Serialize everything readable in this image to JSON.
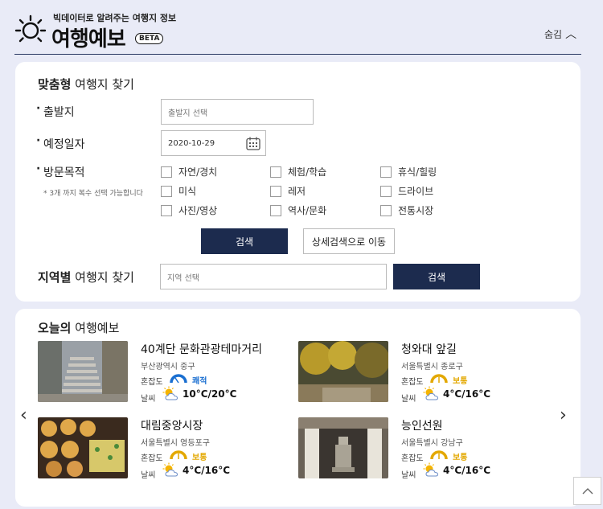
{
  "header": {
    "tagline": "빅데이터로 알려주는 여행지 정보",
    "brand": "여행예보",
    "beta": "BETA",
    "hide_label": "숨김"
  },
  "search": {
    "title_bold": "맞춤형",
    "title_rest": " 여행지 찾기",
    "origin_label": "출발지",
    "origin_placeholder": "출발지 선택",
    "date_label": "예정일자",
    "date_value": "2020-10-29",
    "purpose_label": "방문목적",
    "purpose_hint": "* 3개 까지 복수 선택 가능합니다",
    "purposes": [
      "자연/경치",
      "체험/학습",
      "휴식/힐링",
      "미식",
      "레저",
      "드라이브",
      "사진/영상",
      "역사/문화",
      "전통시장"
    ],
    "search_btn": "검색",
    "detail_btn": "상세검색으로 이동",
    "region_title_bold": "지역별",
    "region_title_rest": " 여행지 찾기",
    "region_placeholder": "지역 선택",
    "region_search_btn": "검색"
  },
  "forecast": {
    "title_bold": "오늘의",
    "title_rest": " 여행예보",
    "crowd_label": "혼잡도",
    "weather_label": "날씨",
    "places": [
      {
        "name": "40계단 문화관광테마거리",
        "address": "부산광역시 중구",
        "crowd": "쾌적",
        "temp": "10°C/20°C"
      },
      {
        "name": "청와대 앞길",
        "address": "서울특별시 종로구",
        "crowd": "보통",
        "temp": "4°C/16°C"
      },
      {
        "name": "대림중앙시장",
        "address": "서울특별시 영등포구",
        "crowd": "보통",
        "temp": "4°C/16°C"
      },
      {
        "name": "능인선원",
        "address": "서울특별시 강남구",
        "crowd": "보통",
        "temp": "4°C/16°C"
      }
    ]
  },
  "colors": {
    "accent_dark": "#1c2b4e",
    "crowd_good": "#1a6fd1",
    "crowd_normal": "#e3a800"
  }
}
